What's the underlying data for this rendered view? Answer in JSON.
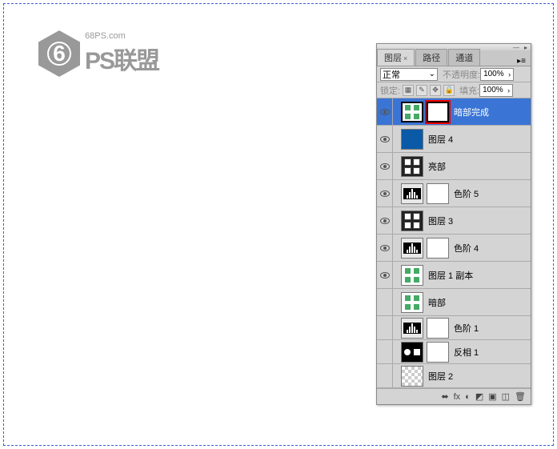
{
  "logo": {
    "url": "68PS.com",
    "brand": "PS联盟"
  },
  "panel": {
    "tabs": {
      "layers": "图层",
      "paths": "路径",
      "channels": "通道"
    },
    "blend_mode": "正常",
    "opacity_label": "不透明度:",
    "opacity_value": "100%",
    "lock_label": "锁定:",
    "fill_label": "填充:",
    "fill_value": "100%"
  },
  "layers": [
    {
      "name": "暗部完成",
      "visible": true,
      "selected": true,
      "mask": true,
      "mask_redbox": true,
      "thumb": "dice"
    },
    {
      "name": "图层 4",
      "visible": true,
      "thumb": "blue"
    },
    {
      "name": "亮部",
      "visible": true,
      "thumb": "dice-dark"
    },
    {
      "name": "色阶 5",
      "visible": true,
      "thumb": "levels",
      "mask": true
    },
    {
      "name": "图层 3",
      "visible": true,
      "thumb": "dice-dark"
    },
    {
      "name": "色阶 4",
      "visible": true,
      "thumb": "levels",
      "mask": true
    },
    {
      "name": "图层 1 副本",
      "visible": true,
      "thumb": "dice"
    },
    {
      "name": "暗部",
      "visible": false,
      "thumb": "dice"
    },
    {
      "name": "色阶 1",
      "visible": false,
      "thumb": "levels",
      "mask": true
    },
    {
      "name": "反相 1",
      "visible": false,
      "thumb": "invert",
      "mask": true
    },
    {
      "name": "图层 2",
      "visible": false,
      "thumb": "checker"
    }
  ],
  "footer_icons": [
    "⬌",
    "fx",
    "◐",
    "◩",
    "▣",
    "◫",
    "🗑"
  ]
}
